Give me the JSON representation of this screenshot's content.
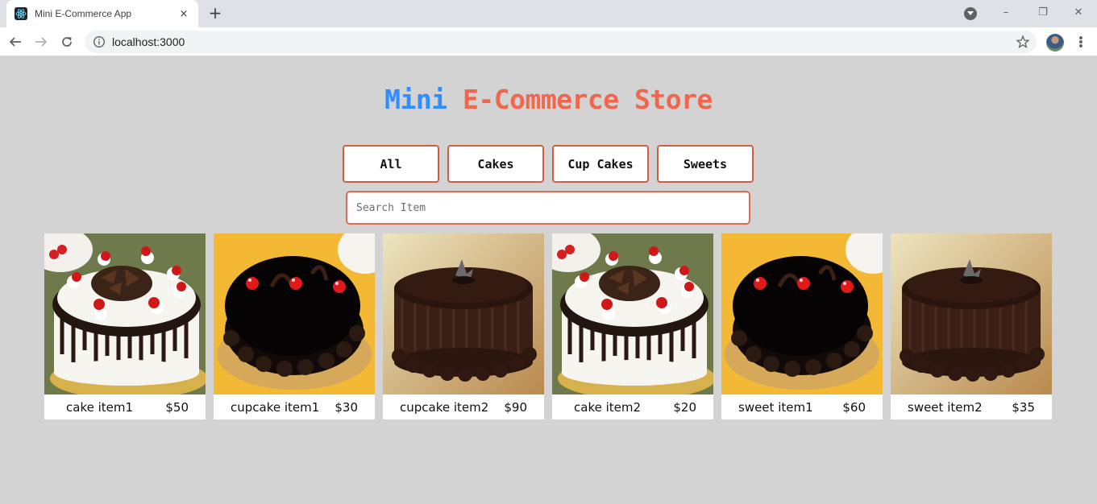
{
  "browser": {
    "tab_title": "Mini E-Commerce App",
    "tab_close": "×",
    "new_tab": "+",
    "url": "localhost:3000",
    "window_minimize": "–",
    "window_restore": "❐",
    "window_close": "✕"
  },
  "page": {
    "title_part1": "Mini",
    "title_part2": "E-Commerce Store",
    "title_colors": {
      "part1": "#2f8dff",
      "part2": "#f0674d"
    },
    "background": "#d3d3d3",
    "filters": [
      {
        "label": "All"
      },
      {
        "label": "Cakes"
      },
      {
        "label": "Cup Cakes"
      },
      {
        "label": "Sweets"
      }
    ],
    "search": {
      "placeholder": "Search Item",
      "value": ""
    },
    "products": [
      {
        "name": "cake item1",
        "price": "$50",
        "image": "black-forest-cake-image"
      },
      {
        "name": "cupcake item1",
        "price": "$30",
        "image": "chocolate-cherry-cake-image"
      },
      {
        "name": "cupcake item2",
        "price": "$90",
        "image": "chocolate-truffle-cake-image"
      },
      {
        "name": "cake item2",
        "price": "$20",
        "image": "black-forest-cake-image"
      },
      {
        "name": "sweet item1",
        "price": "$60",
        "image": "chocolate-cherry-cake-image"
      },
      {
        "name": "sweet item2",
        "price": "$35",
        "image": "chocolate-truffle-cake-image"
      }
    ]
  }
}
